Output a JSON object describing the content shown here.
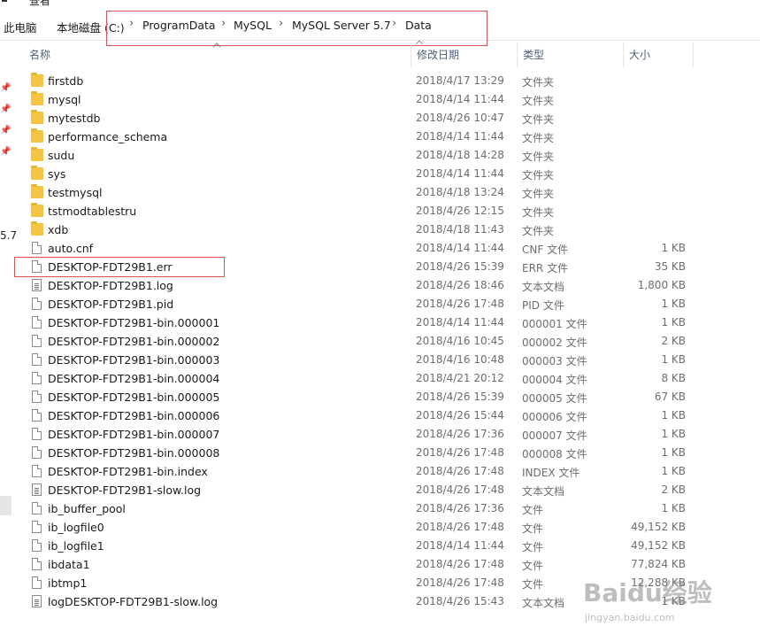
{
  "ribbon": {
    "view_tab": "查看"
  },
  "breadcrumb": [
    "此电脑",
    "本地磁盘 (C:)",
    "ProgramData",
    "MySQL",
    "MySQL Server 5.7",
    "Data"
  ],
  "nav": {
    "fragment_text": "5.7"
  },
  "columns": {
    "name": "名称",
    "modified": "修改日期",
    "type": "类型",
    "size": "大小"
  },
  "files": [
    {
      "name": "firstdb",
      "date": "2018/4/17 13:29",
      "type": "文件夹",
      "size": "",
      "icon": "folder-icon"
    },
    {
      "name": "mysql",
      "date": "2018/4/14 11:44",
      "type": "文件夹",
      "size": "",
      "icon": "folder-icon"
    },
    {
      "name": "mytestdb",
      "date": "2018/4/26 10:47",
      "type": "文件夹",
      "size": "",
      "icon": "folder-icon"
    },
    {
      "name": "performance_schema",
      "date": "2018/4/14 11:44",
      "type": "文件夹",
      "size": "",
      "icon": "folder-icon"
    },
    {
      "name": "sudu",
      "date": "2018/4/18 14:28",
      "type": "文件夹",
      "size": "",
      "icon": "folder-icon"
    },
    {
      "name": "sys",
      "date": "2018/4/14 11:44",
      "type": "文件夹",
      "size": "",
      "icon": "folder-icon"
    },
    {
      "name": "testmysql",
      "date": "2018/4/18 13:24",
      "type": "文件夹",
      "size": "",
      "icon": "folder-icon"
    },
    {
      "name": "tstmodtablestru",
      "date": "2018/4/26 12:15",
      "type": "文件夹",
      "size": "",
      "icon": "folder-icon"
    },
    {
      "name": "xdb",
      "date": "2018/4/18 11:43",
      "type": "文件夹",
      "size": "",
      "icon": "folder-icon"
    },
    {
      "name": "auto.cnf",
      "date": "2018/4/14 11:44",
      "type": "CNF 文件",
      "size": "1 KB",
      "icon": "file-icon"
    },
    {
      "name": "DESKTOP-FDT29B1.err",
      "date": "2018/4/26 15:39",
      "type": "ERR 文件",
      "size": "35 KB",
      "icon": "file-icon"
    },
    {
      "name": "DESKTOP-FDT29B1.log",
      "date": "2018/4/26 18:46",
      "type": "文本文档",
      "size": "1,800 KB",
      "icon": "text-file-icon"
    },
    {
      "name": "DESKTOP-FDT29B1.pid",
      "date": "2018/4/26 17:48",
      "type": "PID 文件",
      "size": "1 KB",
      "icon": "file-icon"
    },
    {
      "name": "DESKTOP-FDT29B1-bin.000001",
      "date": "2018/4/14 11:44",
      "type": "000001 文件",
      "size": "1 KB",
      "icon": "file-icon"
    },
    {
      "name": "DESKTOP-FDT29B1-bin.000002",
      "date": "2018/4/16 10:45",
      "type": "000002 文件",
      "size": "2 KB",
      "icon": "file-icon"
    },
    {
      "name": "DESKTOP-FDT29B1-bin.000003",
      "date": "2018/4/16 10:48",
      "type": "000003 文件",
      "size": "1 KB",
      "icon": "file-icon"
    },
    {
      "name": "DESKTOP-FDT29B1-bin.000004",
      "date": "2018/4/21 20:12",
      "type": "000004 文件",
      "size": "8 KB",
      "icon": "file-icon"
    },
    {
      "name": "DESKTOP-FDT29B1-bin.000005",
      "date": "2018/4/26 15:39",
      "type": "000005 文件",
      "size": "67 KB",
      "icon": "file-icon"
    },
    {
      "name": "DESKTOP-FDT29B1-bin.000006",
      "date": "2018/4/26 15:44",
      "type": "000006 文件",
      "size": "1 KB",
      "icon": "file-icon"
    },
    {
      "name": "DESKTOP-FDT29B1-bin.000007",
      "date": "2018/4/26 17:36",
      "type": "000007 文件",
      "size": "1 KB",
      "icon": "file-icon"
    },
    {
      "name": "DESKTOP-FDT29B1-bin.000008",
      "date": "2018/4/26 17:48",
      "type": "000008 文件",
      "size": "1 KB",
      "icon": "file-icon"
    },
    {
      "name": "DESKTOP-FDT29B1-bin.index",
      "date": "2018/4/26 17:48",
      "type": "INDEX 文件",
      "size": "1 KB",
      "icon": "file-icon"
    },
    {
      "name": "DESKTOP-FDT29B1-slow.log",
      "date": "2018/4/26 17:48",
      "type": "文本文档",
      "size": "2 KB",
      "icon": "text-file-icon"
    },
    {
      "name": "ib_buffer_pool",
      "date": "2018/4/26 17:36",
      "type": "文件",
      "size": "1 KB",
      "icon": "file-icon"
    },
    {
      "name": "ib_logfile0",
      "date": "2018/4/26 17:48",
      "type": "文件",
      "size": "49,152 KB",
      "icon": "file-icon"
    },
    {
      "name": "ib_logfile1",
      "date": "2018/4/14 11:44",
      "type": "文件",
      "size": "49,152 KB",
      "icon": "file-icon"
    },
    {
      "name": "ibdata1",
      "date": "2018/4/26 17:48",
      "type": "文件",
      "size": "77,824 KB",
      "icon": "file-icon"
    },
    {
      "name": "ibtmp1",
      "date": "2018/4/26 17:48",
      "type": "文件",
      "size": "12,288 KB",
      "icon": "file-icon"
    },
    {
      "name": "logDESKTOP-FDT29B1-slow.log",
      "date": "2018/4/26 15:43",
      "type": "文本文档",
      "size": "1 KB",
      "icon": "text-file-icon"
    }
  ],
  "watermark": {
    "brand": "Baidu经验",
    "url": "jingyan.baidu.com"
  },
  "colors": {
    "annotation_red": "#d9534f",
    "folder_yellow": "#f5c542",
    "header_text": "#4c607a"
  }
}
